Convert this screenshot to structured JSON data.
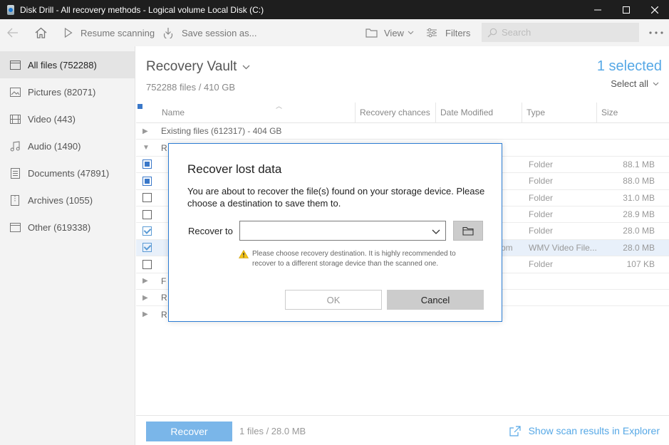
{
  "window": {
    "title": "Disk Drill - All recovery methods - Logical volume Local Disk (C:)",
    "controls": [
      "minimize-icon",
      "maximize-icon",
      "close-icon"
    ]
  },
  "toolbar": {
    "back_icon": "arrow-left-icon",
    "home_icon": "home-icon",
    "resume_label": "Resume scanning",
    "save_label": "Save session as...",
    "view_label": "View",
    "filters_label": "Filters",
    "search_placeholder": "Search",
    "more_icon": "more-dots-icon"
  },
  "sidebar": {
    "items": [
      {
        "label": "All files (752288)",
        "icon": "all-files-icon",
        "active": true
      },
      {
        "label": "Pictures (82071)",
        "icon": "picture-icon"
      },
      {
        "label": "Video (443)",
        "icon": "video-icon"
      },
      {
        "label": "Audio (1490)",
        "icon": "music-icon"
      },
      {
        "label": "Documents (47891)",
        "icon": "document-icon"
      },
      {
        "label": "Archives (1055)",
        "icon": "archive-icon"
      },
      {
        "label": "Other (619338)",
        "icon": "other-icon"
      }
    ]
  },
  "main": {
    "title": "Recovery Vault",
    "subtitle": "752288 files / 410 GB",
    "selected": "1 selected",
    "select_all": "Select all",
    "columns": [
      "Name",
      "Recovery chances",
      "Date Modified",
      "Type",
      "Size"
    ],
    "group_existing": "Existing files (612317) - 404 GB",
    "group_r": "R",
    "group_f": "F",
    "row_types": [
      "Folder",
      "Folder",
      "Folder",
      "Folder",
      "Folder",
      "WMV Video File...",
      "Folder"
    ],
    "row_sizes": [
      "88.1 MB",
      "88.0 MB",
      "31.0 MB",
      "28.9 MB",
      "28.0 MB",
      "28.0 MB",
      "107 KB"
    ],
    "row_date_fragment": "pm"
  },
  "bottom": {
    "recover_label": "Recover",
    "info": "1 files / 28.0 MB",
    "explorer_link": "Show scan results in Explorer"
  },
  "dialog": {
    "title": "Recover lost data",
    "message": "You are about to recover the file(s) found on your storage device. Please choose a destination to save them to.",
    "recover_to_label": "Recover to",
    "recover_to_value": "",
    "warning": "Please choose recovery destination. It is highly recommended to recover to a different storage device than the scanned one.",
    "ok_label": "OK",
    "cancel_label": "Cancel"
  },
  "colors": {
    "accent": "#56a8e6",
    "dialog_border": "#2b7cd3",
    "titlebar": "#1e1e1e"
  }
}
